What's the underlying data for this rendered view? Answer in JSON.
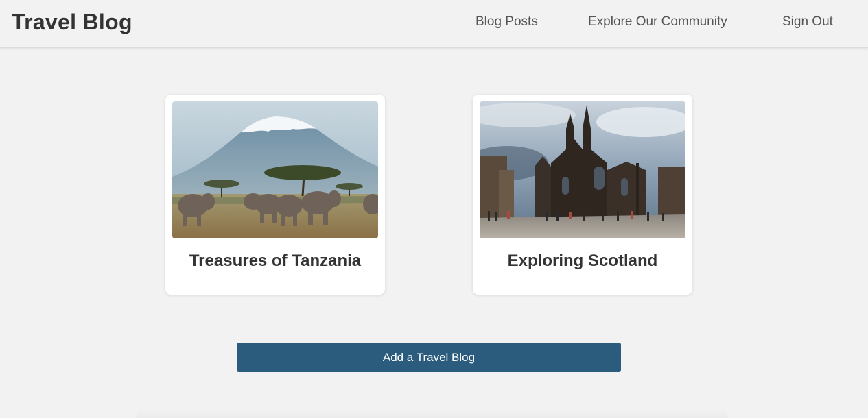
{
  "navbar": {
    "brand": "Travel Blog",
    "links": [
      {
        "label": "Blog Posts"
      },
      {
        "label": "Explore Our Community"
      },
      {
        "label": "Sign Out"
      }
    ]
  },
  "posts": [
    {
      "title": "Treasures of Tanzania",
      "image": "kilimanjaro-elephants-photo"
    },
    {
      "title": "Exploring Scotland",
      "image": "edinburgh-cathedral-photo"
    }
  ],
  "actions": {
    "add_label": "Add a Travel Blog"
  },
  "colors": {
    "background": "#f2f2f2",
    "card": "#ffffff",
    "button": "#2b5c7e",
    "text": "#333333",
    "nav_text": "#555555"
  }
}
